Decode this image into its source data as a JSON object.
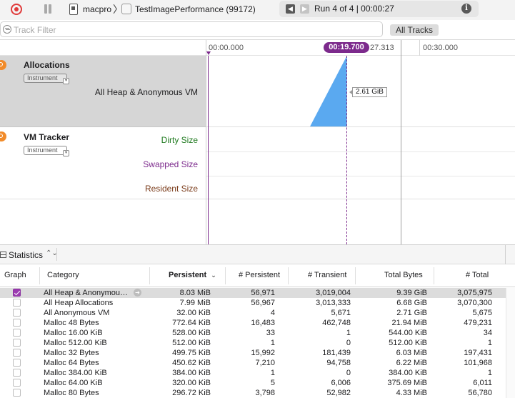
{
  "toolbar": {
    "device": "macpro",
    "separator": "〉",
    "app": "TestImagePerformance (99172)",
    "run_label": "Run 4 of 4  |  00:00:27",
    "prev_glyph": "◀",
    "next_glyph": "▶",
    "info_glyph": "i"
  },
  "filter": {
    "placeholder": "Track Filter",
    "all_tracks": "All Tracks"
  },
  "ruler": {
    "ticks": [
      "00:00.000",
      "27.313",
      "00:30.000"
    ],
    "current_time": "00:19.700"
  },
  "tracks": {
    "allocations": {
      "name": "Allocations",
      "chip": "Instrument",
      "series": "All Heap & Anonymous VM",
      "value_tag": "2.61 GiB"
    },
    "vm_tracker": {
      "name": "VM Tracker",
      "chip": "Instrument",
      "series": [
        "Dirty Size",
        "Swapped Size",
        "Resident Size"
      ]
    }
  },
  "colors": {
    "accent": "#7c2a8c",
    "chart_fill": "#5aa9f0",
    "dirty": "#1f7a1f",
    "swapped": "#7c2a8c",
    "resident": "#7a3b1a",
    "instrument_icon": "#f18b2a",
    "record": "#e03a3a"
  },
  "chart_data": {
    "type": "area",
    "series": [
      {
        "values": [
          0,
          2.61
        ]
      }
    ],
    "x": [
      "00:14.5",
      "00:19.7"
    ]
  },
  "statistics": {
    "label": "Statistics",
    "chevron": "⌃⌄"
  },
  "table": {
    "columns": [
      "Graph",
      "Category",
      "Persistent",
      "# Persistent",
      "# Transient",
      "Total Bytes",
      "# Total"
    ],
    "sort_glyph": "⌄",
    "rows": [
      {
        "checked": true,
        "category": "All Heap & Anonymou…",
        "persistent": "8.03 MiB",
        "n_persistent": "56,971",
        "n_transient": "3,019,004",
        "total_bytes": "9.39 GiB",
        "n_total": "3,075,975"
      },
      {
        "checked": false,
        "category": "All Heap Allocations",
        "persistent": "7.99 MiB",
        "n_persistent": "56,967",
        "n_transient": "3,013,333",
        "total_bytes": "6.68 GiB",
        "n_total": "3,070,300"
      },
      {
        "checked": false,
        "category": "All Anonymous VM",
        "persistent": "32.00 KiB",
        "n_persistent": "4",
        "n_transient": "5,671",
        "total_bytes": "2.71 GiB",
        "n_total": "5,675"
      },
      {
        "checked": false,
        "category": "Malloc 48 Bytes",
        "persistent": "772.64 KiB",
        "n_persistent": "16,483",
        "n_transient": "462,748",
        "total_bytes": "21.94 MiB",
        "n_total": "479,231"
      },
      {
        "checked": false,
        "category": "Malloc 16.00 KiB",
        "persistent": "528.00 KiB",
        "n_persistent": "33",
        "n_transient": "1",
        "total_bytes": "544.00 KiB",
        "n_total": "34"
      },
      {
        "checked": false,
        "category": "Malloc 512.00 KiB",
        "persistent": "512.00 KiB",
        "n_persistent": "1",
        "n_transient": "0",
        "total_bytes": "512.00 KiB",
        "n_total": "1"
      },
      {
        "checked": false,
        "category": "Malloc 32 Bytes",
        "persistent": "499.75 KiB",
        "n_persistent": "15,992",
        "n_transient": "181,439",
        "total_bytes": "6.03 MiB",
        "n_total": "197,431"
      },
      {
        "checked": false,
        "category": "Malloc 64 Bytes",
        "persistent": "450.62 KiB",
        "n_persistent": "7,210",
        "n_transient": "94,758",
        "total_bytes": "6.22 MiB",
        "n_total": "101,968"
      },
      {
        "checked": false,
        "category": "Malloc 384.00 KiB",
        "persistent": "384.00 KiB",
        "n_persistent": "1",
        "n_transient": "0",
        "total_bytes": "384.00 KiB",
        "n_total": "1"
      },
      {
        "checked": false,
        "category": "Malloc 64.00 KiB",
        "persistent": "320.00 KiB",
        "n_persistent": "5",
        "n_transient": "6,006",
        "total_bytes": "375.69 MiB",
        "n_total": "6,011"
      },
      {
        "checked": false,
        "category": "Malloc 80 Bytes",
        "persistent": "296.72 KiB",
        "n_persistent": "3,798",
        "n_transient": "52,982",
        "total_bytes": "4.33 MiB",
        "n_total": "56,780"
      }
    ]
  }
}
